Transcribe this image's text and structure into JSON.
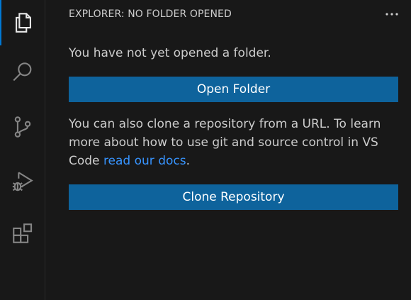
{
  "activity_bar": {
    "items": [
      {
        "icon": "files-icon",
        "active": true
      },
      {
        "icon": "search-icon",
        "active": false
      },
      {
        "icon": "source-control-icon",
        "active": false
      },
      {
        "icon": "run-debug-icon",
        "active": false
      },
      {
        "icon": "extensions-icon",
        "active": false
      }
    ]
  },
  "sidebar": {
    "header": {
      "title": "EXPLORER: NO FOLDER OPENED",
      "more_icon": "ellipsis-icon"
    },
    "message_no_folder": "You have not yet opened a folder.",
    "open_folder_button": "Open Folder",
    "clone_text_before": "You can also clone a repository from a URL. To learn more about how to use git and source control in VS Code ",
    "clone_text_link": "read our docs",
    "clone_text_after": ".",
    "clone_repository_button": "Clone Repository"
  },
  "colors": {
    "background": "#181818",
    "button": "#0e639c",
    "link": "#3794ff",
    "active_indicator": "#0078d4",
    "text": "#cccccc",
    "icon": "#858585"
  }
}
